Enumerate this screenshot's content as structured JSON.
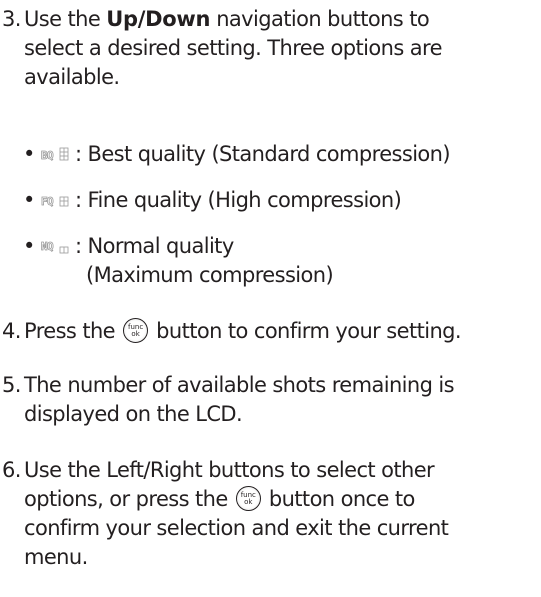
{
  "step3": {
    "num": "3.",
    "text_before": "Use the ",
    "bold": "Up/Down",
    "line1_after": " navigation buttons to",
    "line2": "select a desired setting. Three options are",
    "line3": "available."
  },
  "options": [
    {
      "icon": "BQ",
      "line1": ": Best quality (Standard compression)",
      "line2": ""
    },
    {
      "icon": "FQ",
      "line1": ": Fine quality (High compression)",
      "line2": ""
    },
    {
      "icon": "NQ",
      "line1": ": Normal quality",
      "line2": "(Maximum compression)"
    }
  ],
  "func_button": {
    "top": "func",
    "bottom": "ok"
  },
  "step4": {
    "num": "4.",
    "before": "Press the ",
    "after": " button to confirm your setting."
  },
  "step5": {
    "num": "5.",
    "line1": "The number of available shots remaining is",
    "line2": "displayed on the LCD."
  },
  "step6": {
    "num": "6.",
    "line1": "Use the Left/Right buttons to select other",
    "line2_before": "options, or press the ",
    "line2_after": " button once to",
    "line3": "confirm your selection and exit the current",
    "line4": "menu."
  }
}
